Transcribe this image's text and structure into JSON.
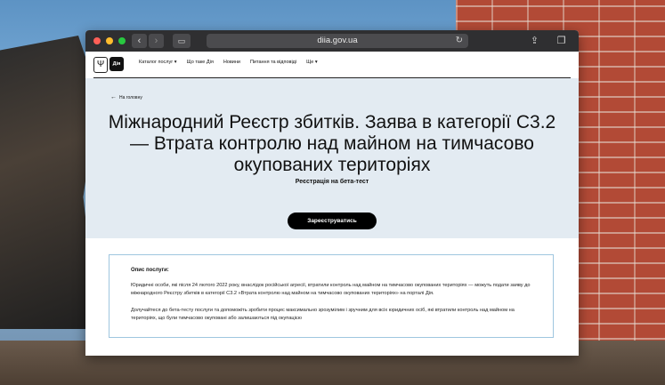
{
  "browser": {
    "url": "diia.gov.ua",
    "back_icon": "‹",
    "forward_icon": "›",
    "reload_icon": "↻",
    "share_icon": "⇪",
    "tabs_icon": "❐",
    "sidebar_icon": "▭"
  },
  "nav": {
    "logo_tryzub": "Ψ",
    "logo_diia": "Дія",
    "items": [
      {
        "label": "Каталог послуг ▾"
      },
      {
        "label": "Що таке Дія"
      },
      {
        "label": "Новини"
      },
      {
        "label": "Питання та відповіді"
      },
      {
        "label": "Ще ▾"
      }
    ]
  },
  "hero": {
    "back_arrow": "←",
    "back_label": "На головну",
    "title": "Міжнародний Реєстр збитків. Заява в категорії С3.2 — Втрата контролю над майном на тимчасово окупованих територіях",
    "subtitle": "Реєстрація на бета-тест",
    "register_button": "Зареєструватись"
  },
  "description": {
    "label": "Опис послуги:",
    "paragraph1": "Юридичні особи, які після 24 лютого 2022 року, внаслідок російської агресії, втратили контроль над майном на тимчасово окупованих територіях — можуть подати заяву до міжнародного Реєстру збитків в категорії С3.2 «Втрата контролю над майном на тимчасово окупованих територіях» на порталі Дія.",
    "paragraph2": "Долучайтеся до бета-тесту послуги та допоможіть зробити процес максимально зрозумілим і зручним для всіх юридичних осіб, які втратили контроль над майном на територіях, що були тимчасово окуповані або залишаються під окупацією"
  },
  "colors": {
    "hero_bg": "#e3ebf2",
    "button_bg": "#000000",
    "box_border": "#9fc6df"
  }
}
